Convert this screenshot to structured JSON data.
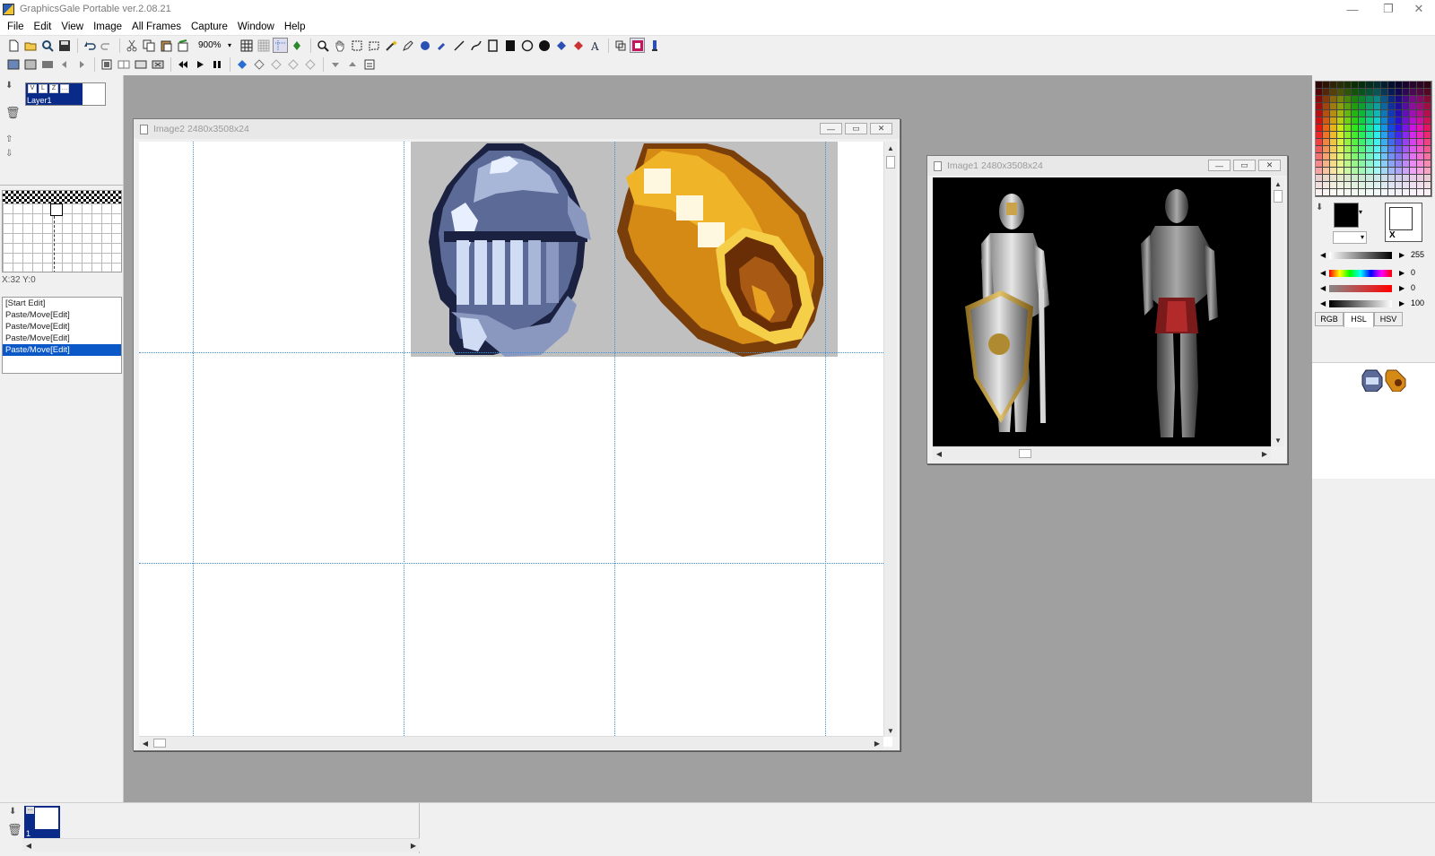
{
  "app": {
    "title": "GraphicsGale Portable ver.2.08.21",
    "window_controls": [
      "—",
      "❐",
      "✕"
    ]
  },
  "menu": [
    "File",
    "Edit",
    "View",
    "Image",
    "All Frames",
    "Capture",
    "Window",
    "Help"
  ],
  "toolbar": {
    "zoom": "900%"
  },
  "layers": {
    "layer1_label": "Layer1"
  },
  "status": {
    "coords": "X:32 Y:0"
  },
  "history": {
    "items": [
      "[Start Edit]",
      "Paste/Move[Edit]",
      "Paste/Move[Edit]",
      "Paste/Move[Edit]",
      "Paste/Move[Edit]"
    ],
    "active_index": 4
  },
  "windows": {
    "image2_title": "Image2  2480x3508x24",
    "image1_title": "Image1  2480x3508x24"
  },
  "color_panel": {
    "value_a": "255",
    "value_b": "0",
    "value_c": "0",
    "value_d": "100",
    "tabs": [
      "RGB",
      "HSL",
      "HSV"
    ],
    "active_tab": "HSL",
    "bg_marker": "X"
  },
  "colors": {
    "selection": "#0a57c8",
    "guide": "#3a8fd6",
    "workspace": "#a0a0a0",
    "sprite_bg": "#c0c0c0"
  },
  "frames": {
    "frame_label": "1"
  }
}
